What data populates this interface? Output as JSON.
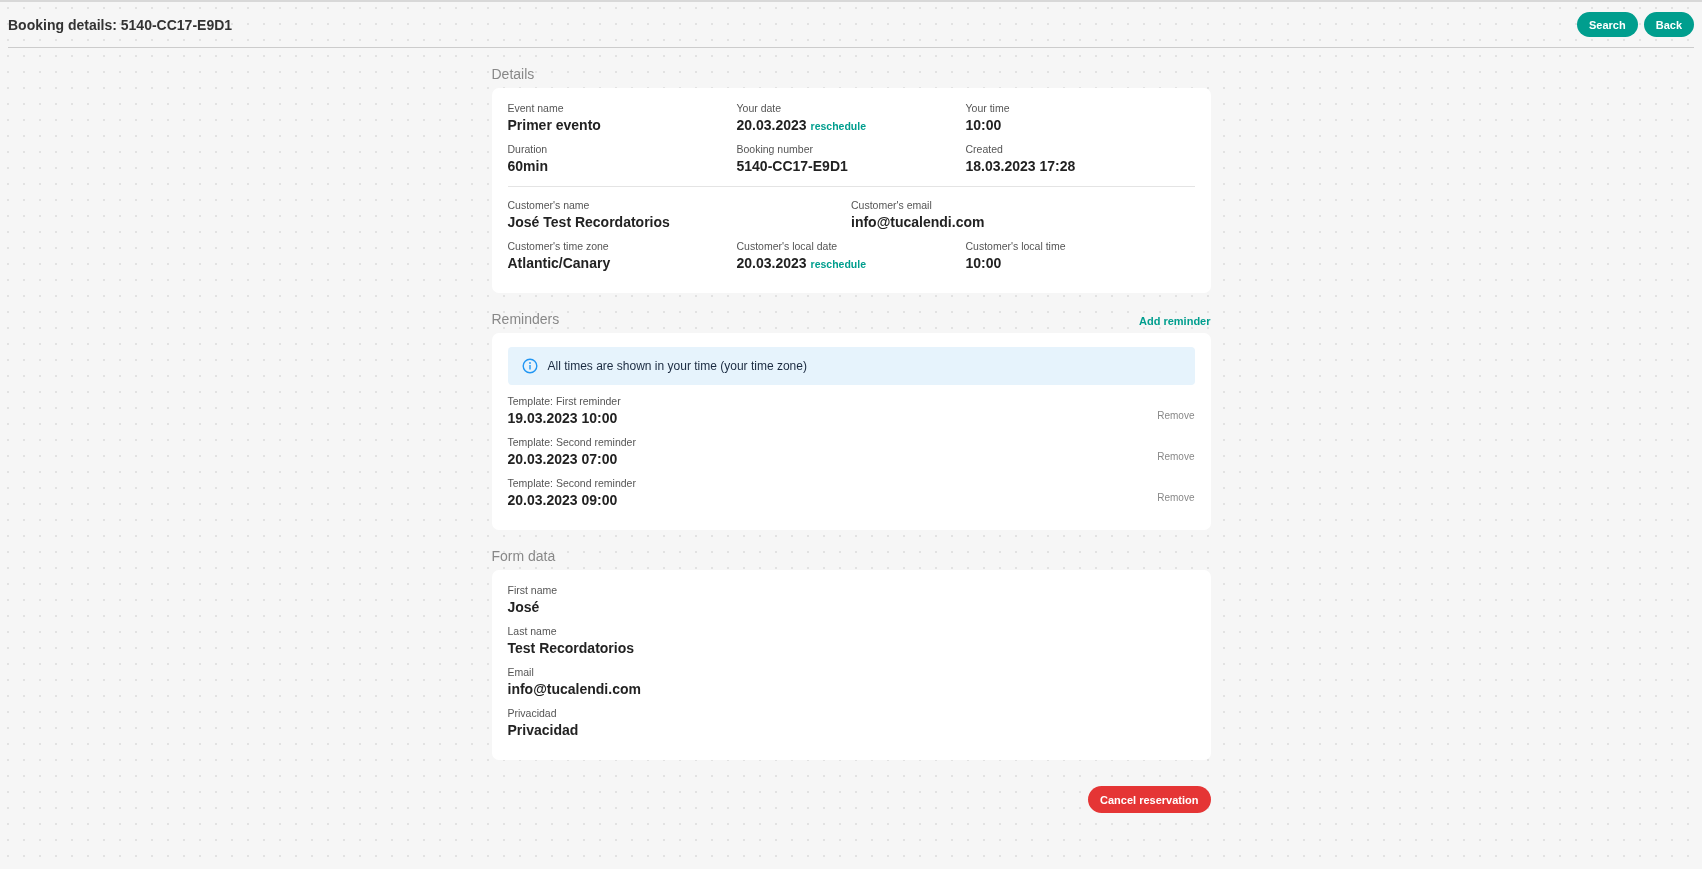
{
  "header": {
    "title": "Booking details: 5140-CC17-E9D1",
    "buttons": [
      "Search",
      "Back"
    ]
  },
  "details": {
    "heading": "Details",
    "groups": [
      [
        [
          {
            "label": "Event name",
            "value": "Primer evento"
          },
          {
            "label": "Your date",
            "value": "20.03.2023",
            "link": "reschedule"
          },
          {
            "label": "Your time",
            "value": "10:00"
          }
        ],
        [
          {
            "label": "Duration",
            "value": "60min"
          },
          {
            "label": "Booking number",
            "value": "5140-CC17-E9D1"
          },
          {
            "label": "Created",
            "value": "18.03.2023 17:28"
          }
        ]
      ],
      [
        [
          {
            "label": "Customer's name",
            "value": "José Test Recordatorios"
          },
          {
            "label": "Customer's email",
            "value": "info@tucalendi.com"
          }
        ],
        [
          {
            "label": "Customer's time zone",
            "value": "Atlantic/Canary"
          },
          {
            "label": "Customer's local date",
            "value": "20.03.2023",
            "link": "reschedule"
          },
          {
            "label": "Customer's local time",
            "value": "10:00"
          }
        ]
      ]
    ]
  },
  "reminders": {
    "heading": "Reminders",
    "action": "Add reminder",
    "notice": "All times are shown in your time (your time zone)",
    "items": [
      {
        "label": "Template: First reminder",
        "value": "19.03.2023 10:00",
        "action": "Remove"
      },
      {
        "label": "Template: Second reminder",
        "value": "20.03.2023 07:00",
        "action": "Remove"
      },
      {
        "label": "Template: Second reminder",
        "value": "20.03.2023 09:00",
        "action": "Remove"
      }
    ]
  },
  "form_data": {
    "heading": "Form data",
    "fields": [
      {
        "label": "First name",
        "value": "José"
      },
      {
        "label": "Last name",
        "value": "Test Recordatorios"
      },
      {
        "label": "Email",
        "value": "info@tucalendi.com"
      },
      {
        "label": "Privacidad",
        "value": "Privacidad"
      }
    ]
  },
  "footer": {
    "button": "Cancel reservation"
  }
}
